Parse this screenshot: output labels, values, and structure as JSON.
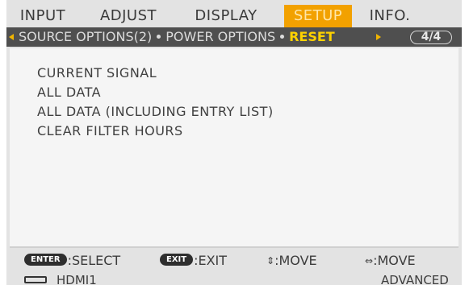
{
  "tabs": [
    {
      "label": "INPUT",
      "active": false
    },
    {
      "label": "ADJUST",
      "active": false
    },
    {
      "label": "DISPLAY",
      "active": false
    },
    {
      "label": "SETUP",
      "active": true
    },
    {
      "label": "INFO.",
      "active": false
    }
  ],
  "submenu": {
    "items": [
      {
        "label": "SOURCE OPTIONS(2)",
        "active": false
      },
      {
        "label": "POWER OPTIONS",
        "active": false
      },
      {
        "label": "RESET",
        "active": true
      }
    ],
    "page": "4/4"
  },
  "menu": {
    "items": [
      "CURRENT SIGNAL",
      "ALL DATA",
      "ALL DATA (INCLUDING ENTRY LIST)",
      "CLEAR FILTER HOURS"
    ]
  },
  "help": {
    "enter_key": "ENTER",
    "enter_action": ":SELECT",
    "exit_key": "EXIT",
    "exit_action": ":EXIT",
    "updown_glyph": "⇕",
    "updown_action": ":MOVE",
    "leftright_glyph": "⇔",
    "leftright_action": ":MOVE"
  },
  "status": {
    "source": "HDMI1",
    "mode": "ADVANCED"
  },
  "colors": {
    "accent": "#f2a100",
    "active_text": "#ffd200",
    "subbar_bg": "#4f4f4f"
  }
}
